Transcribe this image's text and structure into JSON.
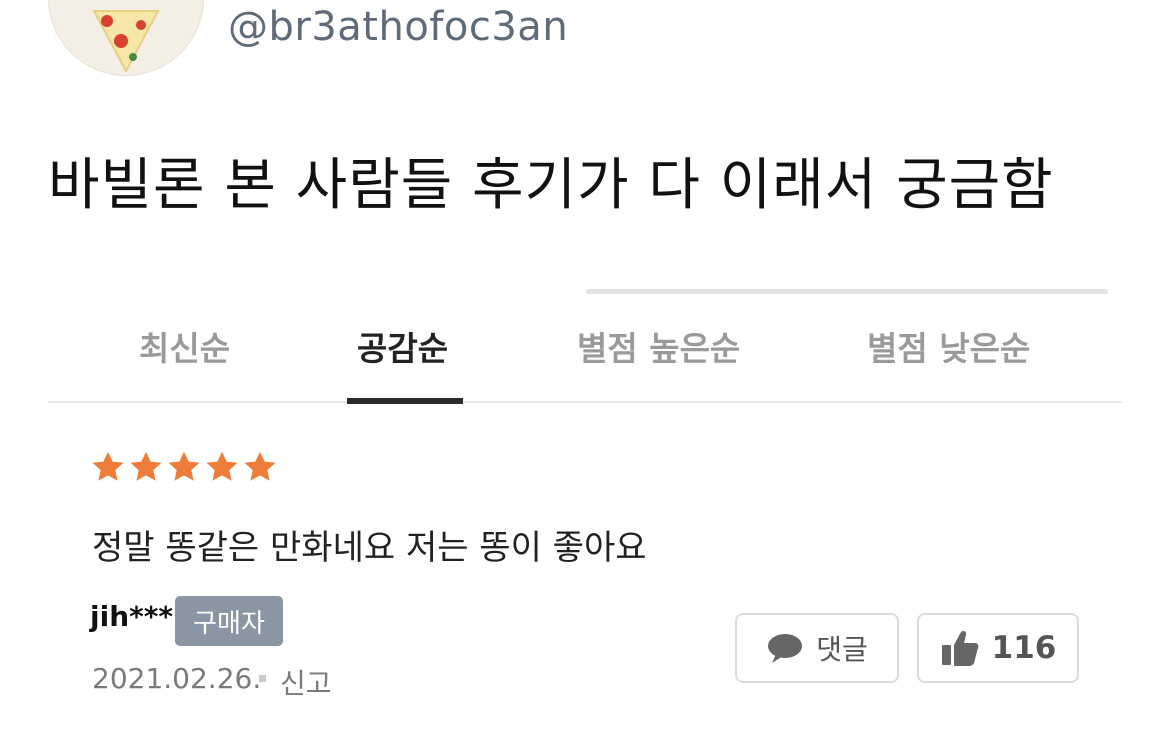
{
  "post": {
    "handle": "@br3athofoc3an",
    "text": "바빌론 본 사람들 후기가 다 이래서 궁금함"
  },
  "tabs": [
    {
      "label": "최신순",
      "active": false
    },
    {
      "label": "공감순",
      "active": true
    },
    {
      "label": "별점 높은순",
      "active": false
    },
    {
      "label": "별점 낮은순",
      "active": false
    }
  ],
  "review": {
    "rating": 5,
    "star_color": "#ee7d3b",
    "text": "정말 똥같은 만화네요 저는 똥이 좋아요",
    "username": "jih***",
    "badge": "구매자",
    "date": "2021.02.26.",
    "report_label": "신고",
    "comment_label": "댓글",
    "like_count": "116"
  },
  "icons": {
    "comment": "speech-bubble-icon",
    "like": "thumbs-up-icon",
    "star": "star-icon"
  }
}
